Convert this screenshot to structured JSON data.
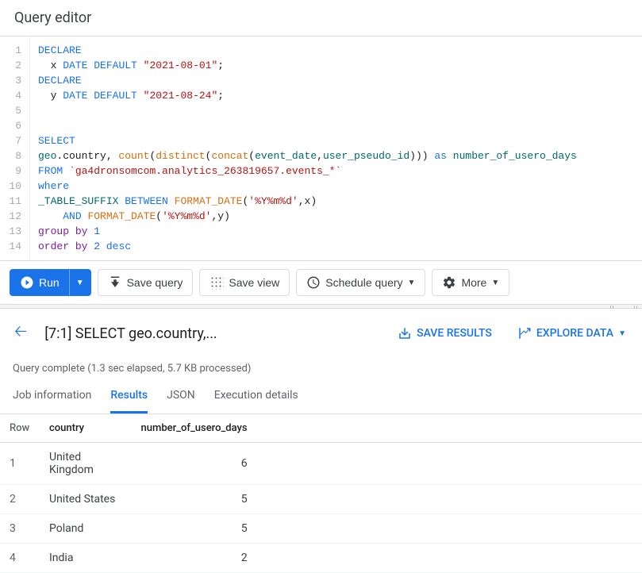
{
  "title": "Query editor",
  "code_lines": [
    [
      [
        "k",
        "DECLARE"
      ]
    ],
    [
      [
        "",
        "  x "
      ],
      [
        "k",
        "DATE"
      ],
      [
        "",
        " "
      ],
      [
        "k",
        "DEFAULT"
      ],
      [
        "",
        " "
      ],
      [
        "s",
        "\"2021-08-01\""
      ],
      [
        "",
        ";"
      ]
    ],
    [
      [
        "k",
        "DECLARE"
      ]
    ],
    [
      [
        "",
        "  y "
      ],
      [
        "k",
        "DATE"
      ],
      [
        "",
        " "
      ],
      [
        "k",
        "DEFAULT"
      ],
      [
        "",
        " "
      ],
      [
        "s",
        "\"2021-08-24\""
      ],
      [
        "",
        ";"
      ]
    ],
    [
      [
        "",
        ""
      ]
    ],
    [
      [
        "",
        ""
      ]
    ],
    [
      [
        "k",
        "SELECT"
      ]
    ],
    [
      [
        "id",
        "geo"
      ],
      [
        "",
        ".country, "
      ],
      [
        "fn",
        "count"
      ],
      [
        "",
        "("
      ],
      [
        "fn",
        "distinct"
      ],
      [
        "",
        "("
      ],
      [
        "fn",
        "concat"
      ],
      [
        "",
        "("
      ],
      [
        "id",
        "event_date"
      ],
      [
        "",
        ","
      ],
      [
        "id",
        "user_pseudo_id"
      ],
      [
        "",
        ")))"
      ],
      [
        "",
        " "
      ],
      [
        "k",
        "as"
      ],
      [
        "",
        " "
      ],
      [
        "id",
        "number_of_usero_days"
      ]
    ],
    [
      [
        "k",
        "FROM"
      ],
      [
        "",
        " "
      ],
      [
        "s",
        "`ga4dronsomcom.analytics_263819657.events_*`"
      ]
    ],
    [
      [
        "k",
        "where"
      ]
    ],
    [
      [
        "id",
        "_TABLE_SUFFIX"
      ],
      [
        "",
        " "
      ],
      [
        "k",
        "BETWEEN"
      ],
      [
        "",
        " "
      ],
      [
        "fn",
        "FORMAT_DATE"
      ],
      [
        "",
        "("
      ],
      [
        "s",
        "'%Y%m%d'"
      ],
      [
        "",
        ",x)"
      ]
    ],
    [
      [
        "",
        "    "
      ],
      [
        "k",
        "AND"
      ],
      [
        "",
        " "
      ],
      [
        "fn",
        "FORMAT_DATE"
      ],
      [
        "",
        "("
      ],
      [
        "s",
        "'%Y%m%d'"
      ],
      [
        "",
        ",y)"
      ]
    ],
    [
      [
        "kw2",
        "group"
      ],
      [
        "",
        " "
      ],
      [
        "kw2",
        "by"
      ],
      [
        "",
        " "
      ],
      [
        "num",
        "1"
      ]
    ],
    [
      [
        "kw2",
        "order"
      ],
      [
        "",
        " "
      ],
      [
        "kw2",
        "by"
      ],
      [
        "",
        " "
      ],
      [
        "num",
        "2"
      ],
      [
        "",
        " "
      ],
      [
        "k",
        "desc"
      ]
    ]
  ],
  "toolbar": {
    "run": "Run",
    "save_query": "Save query",
    "save_view": "Save view",
    "schedule": "Schedule query",
    "more": "More"
  },
  "results_header": {
    "breadcrumb": "[7:1] SELECT geo.country,...",
    "save_results": "SAVE RESULTS",
    "explore_data": "EXPLORE DATA"
  },
  "status_text": "Query complete (1.3 sec elapsed, 5.7 KB processed)",
  "tabs": {
    "job": "Job information",
    "results": "Results",
    "json": "JSON",
    "exec": "Execution details"
  },
  "table": {
    "headers": {
      "row": "Row",
      "c1": "country",
      "c2": "number_of_usero_days"
    },
    "rows": [
      {
        "n": "1",
        "country": "United Kingdom",
        "val": "6"
      },
      {
        "n": "2",
        "country": "United States",
        "val": "5"
      },
      {
        "n": "3",
        "country": "Poland",
        "val": "5"
      },
      {
        "n": "4",
        "country": "India",
        "val": "2"
      }
    ]
  }
}
